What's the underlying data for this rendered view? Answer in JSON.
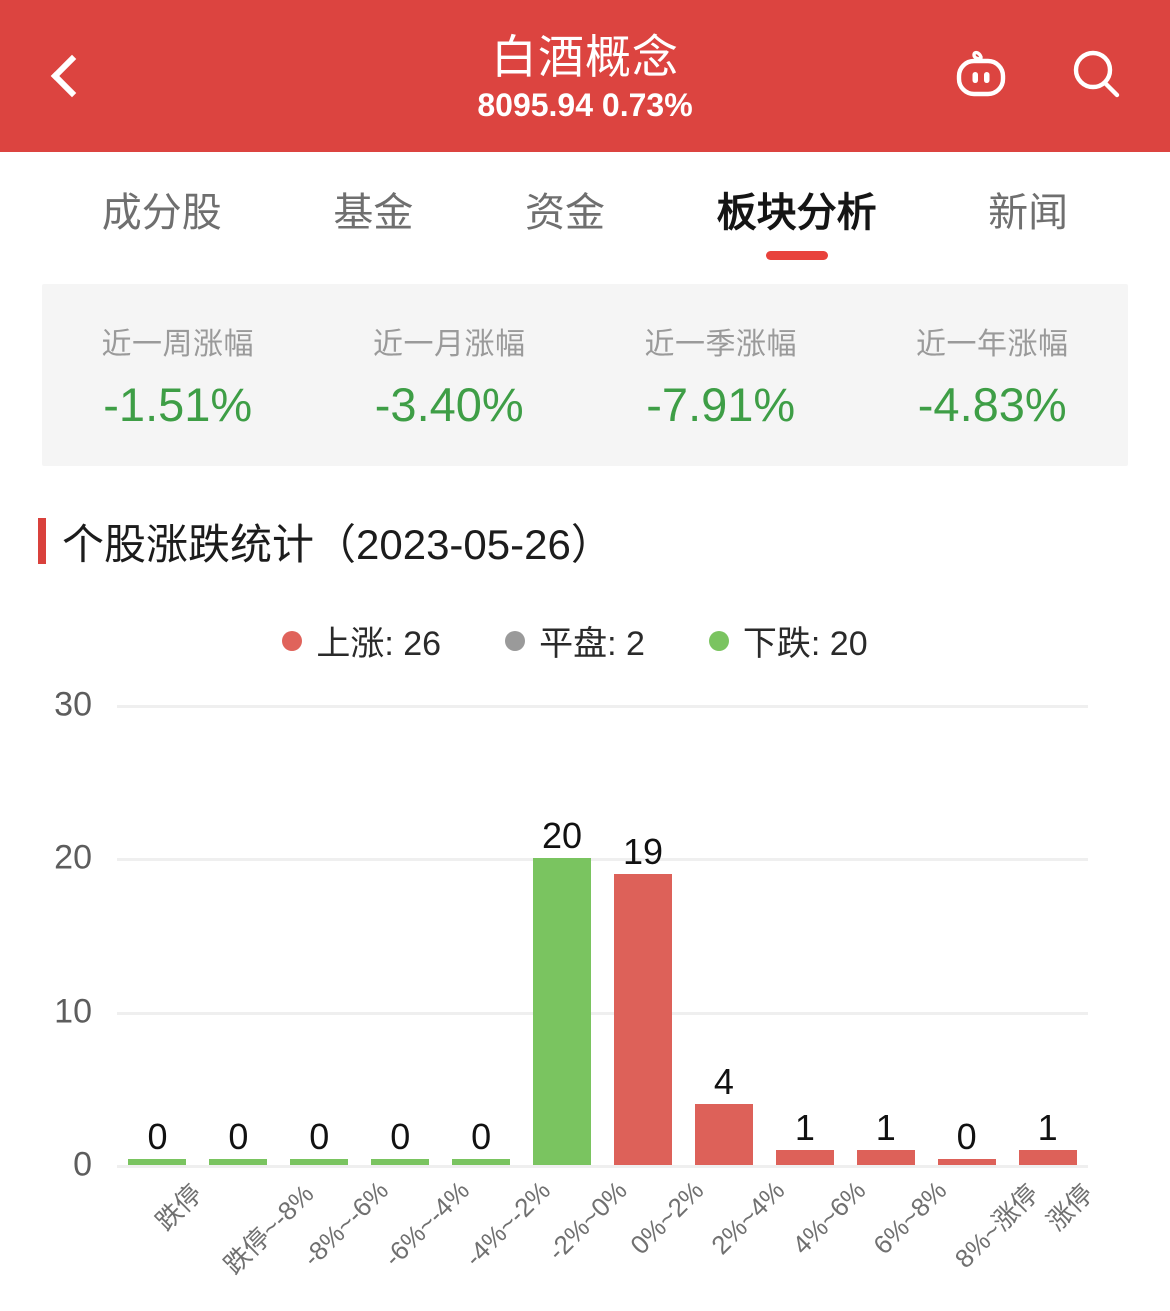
{
  "header": {
    "back_icon": "chevron-left-icon",
    "title": "白酒概念",
    "subtitle": "8095.94 0.73%",
    "robot_icon": "robot-assistant-icon",
    "search_icon": "search-icon",
    "bg_color": "#dc4440"
  },
  "tabs": [
    {
      "label": "成分股",
      "active": false
    },
    {
      "label": "基金",
      "active": false
    },
    {
      "label": "资金",
      "active": false
    },
    {
      "label": "板块分析",
      "active": true
    },
    {
      "label": "新闻",
      "active": false
    }
  ],
  "stats": [
    {
      "label": "近一周涨幅",
      "value": "-1.51%"
    },
    {
      "label": "近一月涨幅",
      "value": "-3.40%"
    },
    {
      "label": "近一季涨幅",
      "value": "-7.91%"
    },
    {
      "label": "近一年涨幅",
      "value": "-4.83%"
    }
  ],
  "section": {
    "title": "个股涨跌统计（2023-05-26）"
  },
  "legend": [
    {
      "label": "上涨: 26",
      "color": "#e0635b"
    },
    {
      "label": "平盘: 2",
      "color": "#9a9a9a"
    },
    {
      "label": "下跌: 20",
      "color": "#7ac460"
    }
  ],
  "colors": {
    "up": "#dd6159",
    "flat": "#9a9a9a",
    "down": "#7ac460",
    "brand": "#dc4440",
    "accent": "#e8423c"
  },
  "chart_data": {
    "type": "bar",
    "title": "个股涨跌统计（2023-05-26）",
    "xlabel": "",
    "ylabel": "",
    "ylim": [
      0,
      30
    ],
    "yticks": [
      0,
      10,
      20,
      30
    ],
    "grid": true,
    "legend_position": "top-center",
    "categories": [
      "跌停",
      "跌停~-8%",
      "-8%~-6%",
      "-6%~-4%",
      "-4%~-2%",
      "-2%~0%",
      "0%~2%",
      "2%~4%",
      "4%~6%",
      "6%~8%",
      "8%~涨停",
      "涨停"
    ],
    "values": [
      0,
      0,
      0,
      0,
      0,
      20,
      19,
      4,
      1,
      1,
      0,
      1
    ],
    "bar_colors": [
      "#7ac460",
      "#7ac460",
      "#7ac460",
      "#7ac460",
      "#7ac460",
      "#7ac460",
      "#dd6159",
      "#dd6159",
      "#dd6159",
      "#dd6159",
      "#dd6159",
      "#dd6159"
    ],
    "data_labels": [
      "0",
      "0",
      "0",
      "0",
      "0",
      "20",
      "19",
      "4",
      "1",
      "1",
      "0",
      "1"
    ],
    "legend": [
      {
        "name": "上涨",
        "value": 26,
        "color": "#e0635b"
      },
      {
        "name": "平盘",
        "value": 2,
        "color": "#9a9a9a"
      },
      {
        "name": "下跌",
        "value": 20,
        "color": "#7ac460"
      }
    ]
  }
}
